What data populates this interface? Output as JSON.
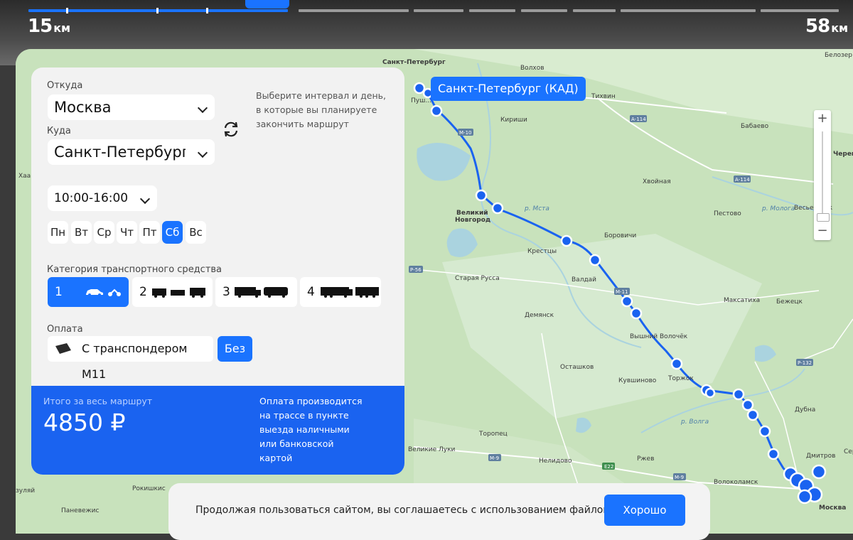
{
  "progress": {
    "start_km": "15",
    "end_km": "58",
    "unit": "км"
  },
  "map": {
    "callout": "Санкт-Петербург (КАД)",
    "labels": [
      "Санкт-Петербург",
      "Волхов",
      "Тихвин",
      "Бабаево",
      "Белозер",
      "Пуш...",
      "Кириши",
      "Хвойная",
      "Череп",
      "Весьегонск",
      "Пестово",
      "Великий",
      "Новгород",
      "Боровичи",
      "Крестцы",
      "Валдай",
      "Старая Русса",
      "Демянск",
      "Вышний Волочёк",
      "Максатиха",
      "Бежецк",
      "Осташков",
      "Кувшиново",
      "Торжок",
      "Дубна",
      "Торопец",
      "Великие Луки",
      "Нелидово",
      "Ржев",
      "Дмитров",
      "Волоколамск",
      "Москва",
      "Рокишкис",
      "Паневежис",
      "Хаап",
      "зуляй",
      "р. Мста",
      "р. Волга",
      "р. Молога",
      "Серг",
      "Волхов р."
    ],
    "road_shields": [
      "М-10",
      "А-114",
      "М-11",
      "А-114",
      "Р-56",
      "Р-132",
      "М-9",
      "Е22",
      "М-9",
      "Р-"
    ],
    "zoom_in": "+",
    "zoom_out": "−"
  },
  "form": {
    "from_label": "Откуда",
    "from_value": "Москва",
    "to_label": "Куда",
    "to_value": "Санкт-Петербург",
    "hint": "Выберите интервал и день, в которые вы планируете закончить маршрут",
    "time_value": "10:00-16:00",
    "days": [
      "Пн",
      "Вт",
      "Ср",
      "Чт",
      "Пт",
      "Сб",
      "Вс"
    ],
    "selected_day": "Сб",
    "vehicle_label": "Категория транспортного средства",
    "vehicle_categories": [
      "1",
      "2",
      "3",
      "4"
    ],
    "selected_category": "1",
    "payment_label": "Оплата",
    "payment_options": [
      "С транспондером М11",
      "Без"
    ],
    "selected_payment": "Без"
  },
  "total": {
    "label": "Итого за весь маршрут",
    "value": "4850 ₽",
    "note": "Оплата производится на трассе в пункте выезда наличными или банковской картой"
  },
  "cookie": {
    "text": "Продолжая пользоваться сайтом, вы соглашаетесь с использованием файлов cookie",
    "button": "Хорошо"
  },
  "colors": {
    "accent": "#1a73ff",
    "total_bg": "#1a63f0",
    "map_land": "#c9e3bd",
    "water": "#aad3df"
  }
}
